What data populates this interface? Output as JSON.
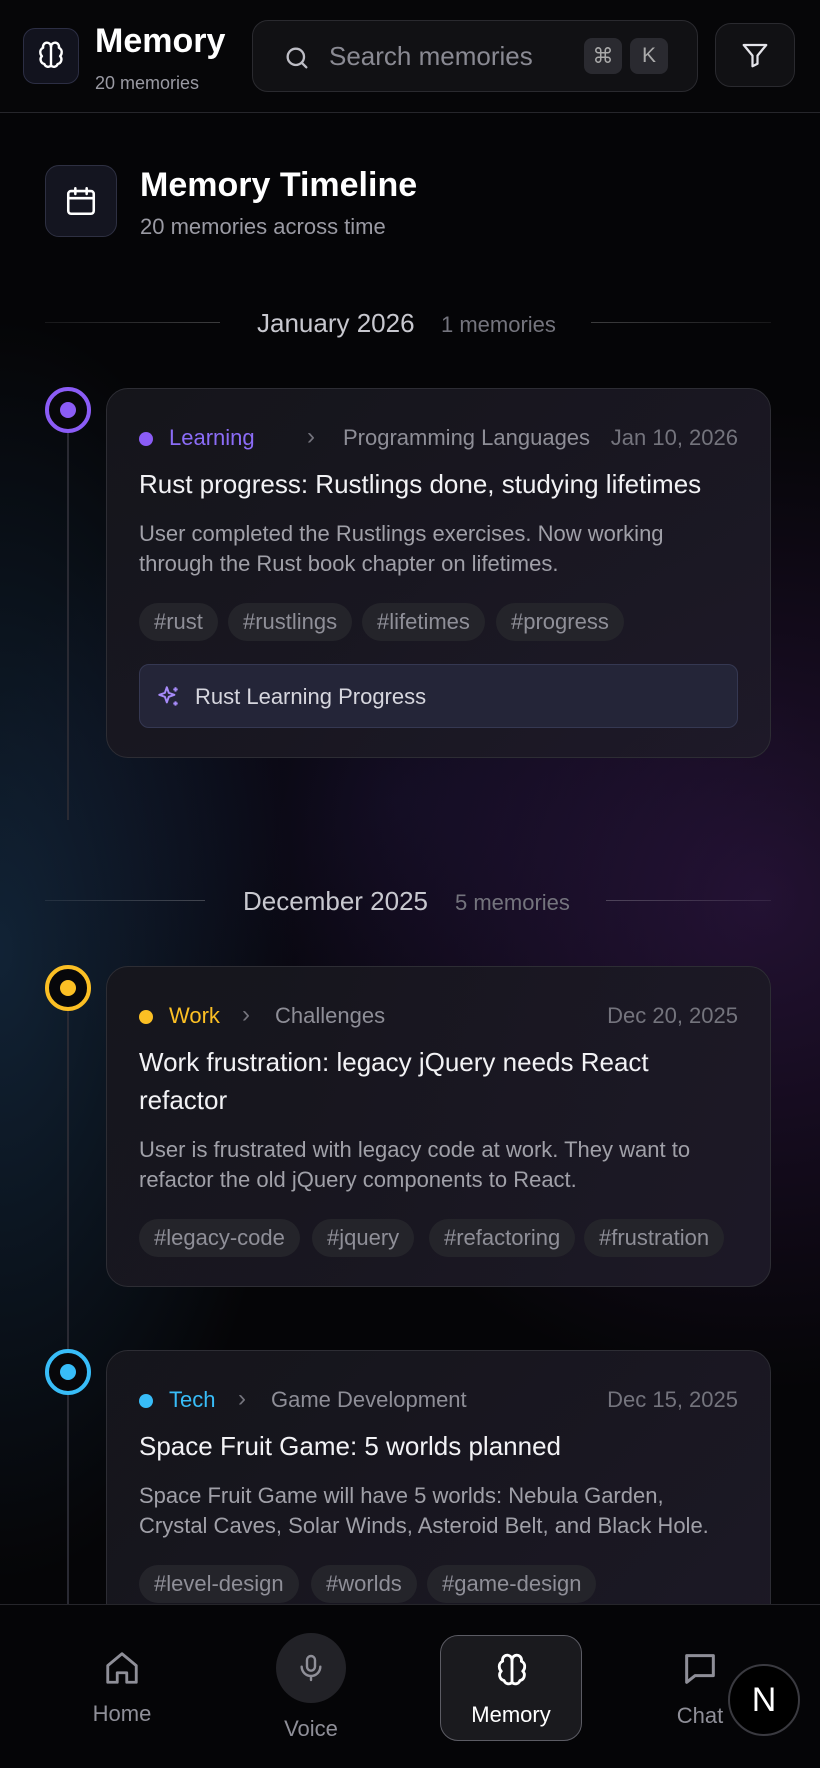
{
  "header": {
    "title": "Memory",
    "subtitle": "20 memories",
    "search_placeholder": "Search memories",
    "kbd_cmd": "⌘",
    "kbd_k": "K"
  },
  "timeline": {
    "title": "Memory Timeline",
    "subtitle": "20 memories across time"
  },
  "months": [
    {
      "label": "January 2026",
      "count": "1 memories"
    },
    {
      "label": "December 2025",
      "count": "5 memories"
    }
  ],
  "memories": [
    {
      "category": "Learning",
      "category_color": "#8b5cf6",
      "subcategory": "Programming Languages",
      "date": "Jan 10, 2026",
      "title": "Rust progress: Rustlings done, studying lifetimes",
      "description": "User completed the Rustlings exercises. Now working through the Rust book chapter on lifetimes.",
      "tags": [
        "#rust",
        "#rustlings",
        "#lifetimes",
        "#progress"
      ],
      "linked": "Rust Learning Progress"
    },
    {
      "category": "Work",
      "category_color": "#fbbf24",
      "subcategory": "Challenges",
      "date": "Dec 20, 2025",
      "title": "Work frustration: legacy jQuery needs React refactor",
      "description": "User is frustrated with legacy code at work. They want to refactor the old jQuery components to React.",
      "tags": [
        "#legacy-code",
        "#jquery",
        "#refactoring",
        "#frustration"
      ]
    },
    {
      "category": "Tech",
      "category_color": "#38bdf8",
      "subcategory": "Game Development",
      "date": "Dec 15, 2025",
      "title": "Space Fruit Game: 5 worlds planned",
      "description": "Space Fruit Game will have 5 worlds: Nebula Garden, Crystal Caves, Solar Winds, Asteroid Belt, and Black Hole.",
      "tags": [
        "#level-design",
        "#worlds",
        "#game-design"
      ]
    }
  ],
  "nav": {
    "home": "Home",
    "voice": "Voice",
    "memory": "Memory",
    "chat": "Chat",
    "badge": "N"
  }
}
